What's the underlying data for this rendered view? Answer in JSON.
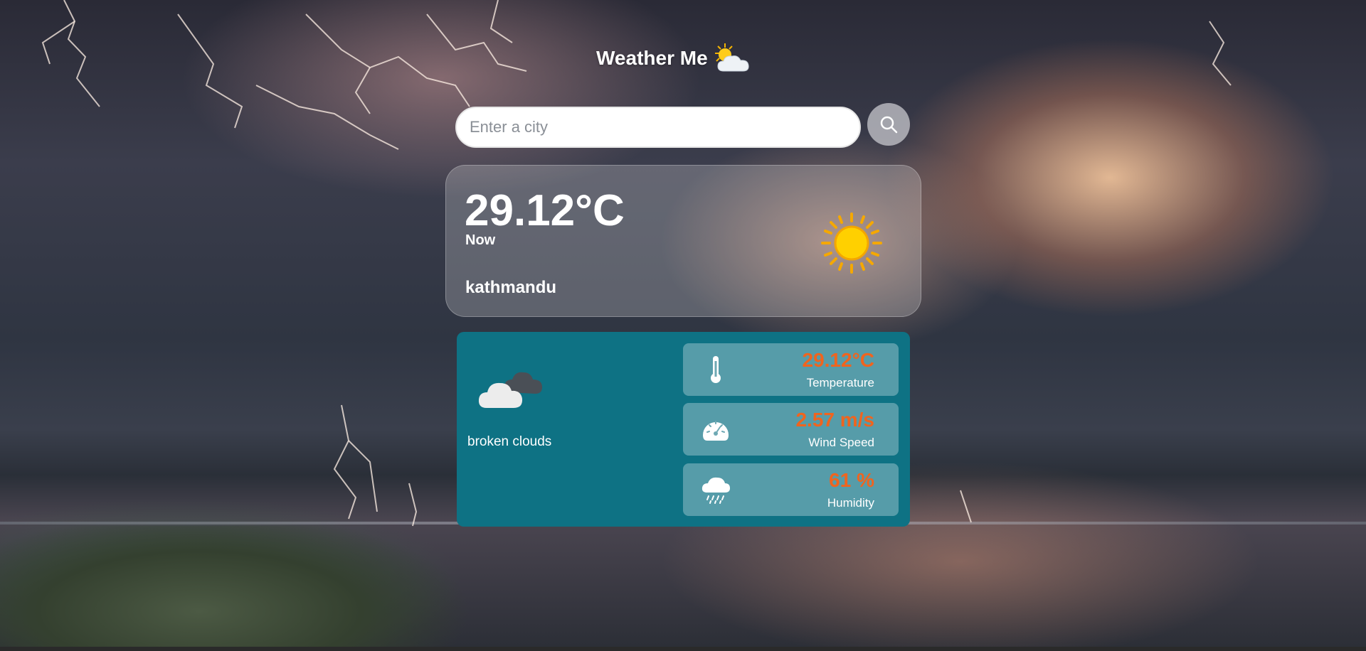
{
  "header": {
    "title": "Weather Me",
    "icon": "sun-behind-cloud-icon"
  },
  "search": {
    "placeholder": "Enter a city",
    "value": "",
    "button_icon": "search-icon"
  },
  "current": {
    "temperature": "29.12°C",
    "time_label": "Now",
    "city": "kathmandu",
    "icon": "sun-icon"
  },
  "details": {
    "condition_icon": "broken-clouds-icon",
    "condition": "broken clouds",
    "stats": [
      {
        "icon": "thermometer-icon",
        "value": "29.12°C",
        "label": "Temperature"
      },
      {
        "icon": "speedometer-icon",
        "value": "2.57 m/s",
        "label": "Wind Speed"
      },
      {
        "icon": "rain-cloud-icon",
        "value": "61 %",
        "label": "Humidity"
      }
    ]
  },
  "colors": {
    "detail_card": "#0e7284",
    "stat_value": "#f0641e",
    "text": "#ffffff"
  }
}
